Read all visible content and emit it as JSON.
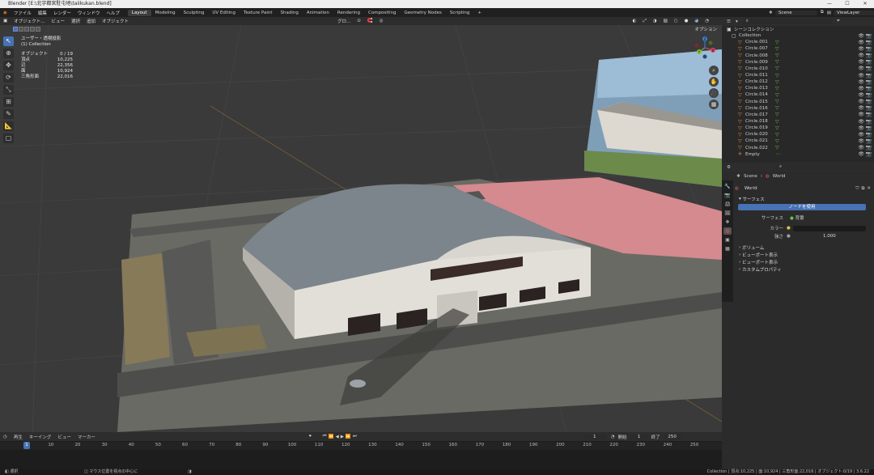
{
  "window": {
    "title": "Blender [E:\\北宇都宮駐屯地\\taiikukan.blend]"
  },
  "menu": [
    "ファイル",
    "編集",
    "レンダー",
    "ウィンドウ",
    "ヘルプ"
  ],
  "workspaces": [
    {
      "label": "Layout",
      "active": true
    },
    {
      "label": "Modeling"
    },
    {
      "label": "Sculpting"
    },
    {
      "label": "UV Editing"
    },
    {
      "label": "Texture Paint"
    },
    {
      "label": "Shading"
    },
    {
      "label": "Animation"
    },
    {
      "label": "Rendering"
    },
    {
      "label": "Compositing"
    },
    {
      "label": "Geometry Nodes"
    },
    {
      "label": "Scripting"
    }
  ],
  "add_workspace": "+",
  "scene_field": "Scene",
  "viewlayer_field": "ViewLayer",
  "viewport": {
    "mode": "オブジェクト...",
    "menus": [
      "ビュー",
      "選択",
      "追加",
      "オブジェクト"
    ],
    "transform_orientation": "グロ...",
    "options": "オプション",
    "overlay_title": "ユーザー・透視投影",
    "overlay_collection": "(1) Collection",
    "stats": [
      {
        "label": "オブジェクト",
        "value": "0 / 19"
      },
      {
        "label": "頂点",
        "value": "10,225"
      },
      {
        "label": "辺",
        "value": "22,356"
      },
      {
        "label": "面",
        "value": "10,924"
      },
      {
        "label": "三角形面",
        "value": "22,016"
      }
    ],
    "gizmo_axes": [
      "X",
      "Y",
      "Z"
    ]
  },
  "outliner": {
    "title": "シーンコレクション",
    "collection": "Collection",
    "items": [
      "Circle.001",
      "Circle.007",
      "Circle.008",
      "Circle.009",
      "Circle.010",
      "Circle.011",
      "Circle.012",
      "Circle.013",
      "Circle.014",
      "Circle.015",
      "Circle.016",
      "Circle.017",
      "Circle.018",
      "Circle.019",
      "Circle.020",
      "Circle.021",
      "Circle.022",
      "Empty"
    ]
  },
  "properties": {
    "breadcrumb": [
      "Scene",
      "World"
    ],
    "world_name": "World",
    "surface_section": "サーフェス",
    "use_nodes_button": "ノードを使用",
    "surface_label": "サーフェス",
    "surface_value": "背景",
    "color_label": "カラー",
    "strength_label": "強さ",
    "strength_value": "1.000",
    "sections": [
      "ボリューム",
      "ビューポート表示",
      "ビューポート表示",
      "カスタムプロパティ"
    ]
  },
  "timeline": {
    "menus": [
      "再生",
      "キーイング",
      "ビュー",
      "マーカー"
    ],
    "current_frame": "1",
    "start_label": "開始",
    "start_value": "1",
    "end_label": "終了",
    "end_value": "250",
    "ticks": [
      "1",
      "10",
      "20",
      "30",
      "40",
      "50",
      "60",
      "70",
      "80",
      "90",
      "100",
      "110",
      "120",
      "130",
      "140",
      "150",
      "160",
      "170",
      "180",
      "190",
      "200",
      "210",
      "220",
      "230",
      "240",
      "250"
    ]
  },
  "status": {
    "left_hint": "選択",
    "mid_hint": "マウス位置を視点の中心に",
    "right_info": "Collection | 頂点:10,225 | 面:10,924 | 三角形面:22,016 | オブジェクト:0/19 | 3.6.22"
  },
  "colors": {
    "accent": "#4772b3",
    "header": "#2d2d2d",
    "viewport_bg": "#3a3a3a",
    "mesh_icon": "#e58d3a",
    "modifier_icon": "#6cc04a"
  }
}
